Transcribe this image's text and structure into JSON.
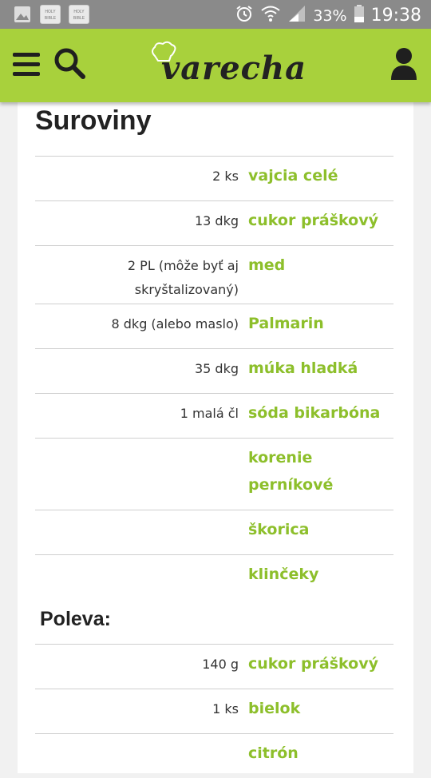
{
  "status_bar": {
    "battery": "33%",
    "time": "19:38",
    "book_label": "HOLY BIBLE"
  },
  "header": {
    "logo_text": "varecha"
  },
  "recipe": {
    "title": "Suroviny",
    "ingredients": [
      {
        "amount": "2 ks",
        "name": "vajcia celé"
      },
      {
        "amount": "13 dkg",
        "name": "cukor práškový"
      },
      {
        "amount": "2 PL (môže byť aj skryštalizovaný)",
        "name": "med"
      },
      {
        "amount": "8 dkg (alebo maslo)",
        "name": "Palmarin"
      },
      {
        "amount": "35 dkg",
        "name": "múka hladká"
      },
      {
        "amount": "1 malá čl",
        "name": "sóda bikarbóna"
      },
      {
        "amount": "",
        "name": "korenie perníkové"
      },
      {
        "amount": "",
        "name": "škorica"
      },
      {
        "amount": "",
        "name": "klinčeky"
      }
    ],
    "section2_title": "Poleva:",
    "section2_ingredients": [
      {
        "amount": "140 g",
        "name": "cukor práškový"
      },
      {
        "amount": "1 ks",
        "name": "bielok"
      },
      {
        "amount": "",
        "name": "citrón"
      }
    ]
  },
  "colors": {
    "brand_green": "#a8d13c",
    "ingredient_green": "#8dbf2b"
  }
}
